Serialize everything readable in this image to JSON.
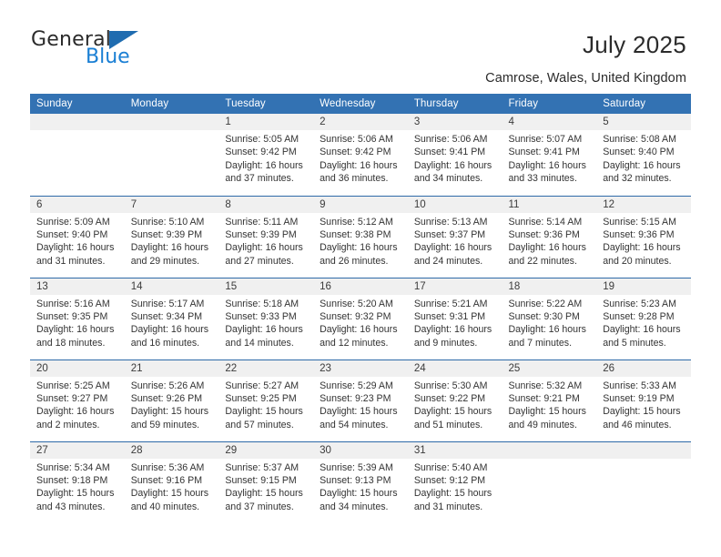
{
  "brand": {
    "name_top": "General",
    "name_bottom": "Blue",
    "triangle_icon": "blue-triangle-logo-icon"
  },
  "header": {
    "title": "July 2025",
    "location": "Camrose, Wales, United Kingdom"
  },
  "colors": {
    "header_blue": "#3372b3",
    "row_divider": "#2e6aa8",
    "daynum_band": "#f0f0f0",
    "brand_blue": "#1a7fd4"
  },
  "calendar": {
    "weekday_headers": [
      "Sunday",
      "Monday",
      "Tuesday",
      "Wednesday",
      "Thursday",
      "Friday",
      "Saturday"
    ],
    "labels": {
      "sunrise": "Sunrise:",
      "sunset": "Sunset:",
      "daylight": "Daylight:"
    },
    "weeks": [
      [
        {
          "day": "",
          "sunrise": "",
          "sunset": "",
          "daylight": ""
        },
        {
          "day": "",
          "sunrise": "",
          "sunset": "",
          "daylight": ""
        },
        {
          "day": "1",
          "sunrise": "Sunrise: 5:05 AM",
          "sunset": "Sunset: 9:42 PM",
          "daylight": "Daylight: 16 hours and 37 minutes."
        },
        {
          "day": "2",
          "sunrise": "Sunrise: 5:06 AM",
          "sunset": "Sunset: 9:42 PM",
          "daylight": "Daylight: 16 hours and 36 minutes."
        },
        {
          "day": "3",
          "sunrise": "Sunrise: 5:06 AM",
          "sunset": "Sunset: 9:41 PM",
          "daylight": "Daylight: 16 hours and 34 minutes."
        },
        {
          "day": "4",
          "sunrise": "Sunrise: 5:07 AM",
          "sunset": "Sunset: 9:41 PM",
          "daylight": "Daylight: 16 hours and 33 minutes."
        },
        {
          "day": "5",
          "sunrise": "Sunrise: 5:08 AM",
          "sunset": "Sunset: 9:40 PM",
          "daylight": "Daylight: 16 hours and 32 minutes."
        }
      ],
      [
        {
          "day": "6",
          "sunrise": "Sunrise: 5:09 AM",
          "sunset": "Sunset: 9:40 PM",
          "daylight": "Daylight: 16 hours and 31 minutes."
        },
        {
          "day": "7",
          "sunrise": "Sunrise: 5:10 AM",
          "sunset": "Sunset: 9:39 PM",
          "daylight": "Daylight: 16 hours and 29 minutes."
        },
        {
          "day": "8",
          "sunrise": "Sunrise: 5:11 AM",
          "sunset": "Sunset: 9:39 PM",
          "daylight": "Daylight: 16 hours and 27 minutes."
        },
        {
          "day": "9",
          "sunrise": "Sunrise: 5:12 AM",
          "sunset": "Sunset: 9:38 PM",
          "daylight": "Daylight: 16 hours and 26 minutes."
        },
        {
          "day": "10",
          "sunrise": "Sunrise: 5:13 AM",
          "sunset": "Sunset: 9:37 PM",
          "daylight": "Daylight: 16 hours and 24 minutes."
        },
        {
          "day": "11",
          "sunrise": "Sunrise: 5:14 AM",
          "sunset": "Sunset: 9:36 PM",
          "daylight": "Daylight: 16 hours and 22 minutes."
        },
        {
          "day": "12",
          "sunrise": "Sunrise: 5:15 AM",
          "sunset": "Sunset: 9:36 PM",
          "daylight": "Daylight: 16 hours and 20 minutes."
        }
      ],
      [
        {
          "day": "13",
          "sunrise": "Sunrise: 5:16 AM",
          "sunset": "Sunset: 9:35 PM",
          "daylight": "Daylight: 16 hours and 18 minutes."
        },
        {
          "day": "14",
          "sunrise": "Sunrise: 5:17 AM",
          "sunset": "Sunset: 9:34 PM",
          "daylight": "Daylight: 16 hours and 16 minutes."
        },
        {
          "day": "15",
          "sunrise": "Sunrise: 5:18 AM",
          "sunset": "Sunset: 9:33 PM",
          "daylight": "Daylight: 16 hours and 14 minutes."
        },
        {
          "day": "16",
          "sunrise": "Sunrise: 5:20 AM",
          "sunset": "Sunset: 9:32 PM",
          "daylight": "Daylight: 16 hours and 12 minutes."
        },
        {
          "day": "17",
          "sunrise": "Sunrise: 5:21 AM",
          "sunset": "Sunset: 9:31 PM",
          "daylight": "Daylight: 16 hours and 9 minutes."
        },
        {
          "day": "18",
          "sunrise": "Sunrise: 5:22 AM",
          "sunset": "Sunset: 9:30 PM",
          "daylight": "Daylight: 16 hours and 7 minutes."
        },
        {
          "day": "19",
          "sunrise": "Sunrise: 5:23 AM",
          "sunset": "Sunset: 9:28 PM",
          "daylight": "Daylight: 16 hours and 5 minutes."
        }
      ],
      [
        {
          "day": "20",
          "sunrise": "Sunrise: 5:25 AM",
          "sunset": "Sunset: 9:27 PM",
          "daylight": "Daylight: 16 hours and 2 minutes."
        },
        {
          "day": "21",
          "sunrise": "Sunrise: 5:26 AM",
          "sunset": "Sunset: 9:26 PM",
          "daylight": "Daylight: 15 hours and 59 minutes."
        },
        {
          "day": "22",
          "sunrise": "Sunrise: 5:27 AM",
          "sunset": "Sunset: 9:25 PM",
          "daylight": "Daylight: 15 hours and 57 minutes."
        },
        {
          "day": "23",
          "sunrise": "Sunrise: 5:29 AM",
          "sunset": "Sunset: 9:23 PM",
          "daylight": "Daylight: 15 hours and 54 minutes."
        },
        {
          "day": "24",
          "sunrise": "Sunrise: 5:30 AM",
          "sunset": "Sunset: 9:22 PM",
          "daylight": "Daylight: 15 hours and 51 minutes."
        },
        {
          "day": "25",
          "sunrise": "Sunrise: 5:32 AM",
          "sunset": "Sunset: 9:21 PM",
          "daylight": "Daylight: 15 hours and 49 minutes."
        },
        {
          "day": "26",
          "sunrise": "Sunrise: 5:33 AM",
          "sunset": "Sunset: 9:19 PM",
          "daylight": "Daylight: 15 hours and 46 minutes."
        }
      ],
      [
        {
          "day": "27",
          "sunrise": "Sunrise: 5:34 AM",
          "sunset": "Sunset: 9:18 PM",
          "daylight": "Daylight: 15 hours and 43 minutes."
        },
        {
          "day": "28",
          "sunrise": "Sunrise: 5:36 AM",
          "sunset": "Sunset: 9:16 PM",
          "daylight": "Daylight: 15 hours and 40 minutes."
        },
        {
          "day": "29",
          "sunrise": "Sunrise: 5:37 AM",
          "sunset": "Sunset: 9:15 PM",
          "daylight": "Daylight: 15 hours and 37 minutes."
        },
        {
          "day": "30",
          "sunrise": "Sunrise: 5:39 AM",
          "sunset": "Sunset: 9:13 PM",
          "daylight": "Daylight: 15 hours and 34 minutes."
        },
        {
          "day": "31",
          "sunrise": "Sunrise: 5:40 AM",
          "sunset": "Sunset: 9:12 PM",
          "daylight": "Daylight: 15 hours and 31 minutes."
        },
        {
          "day": "",
          "sunrise": "",
          "sunset": "",
          "daylight": ""
        },
        {
          "day": "",
          "sunrise": "",
          "sunset": "",
          "daylight": ""
        }
      ]
    ]
  }
}
